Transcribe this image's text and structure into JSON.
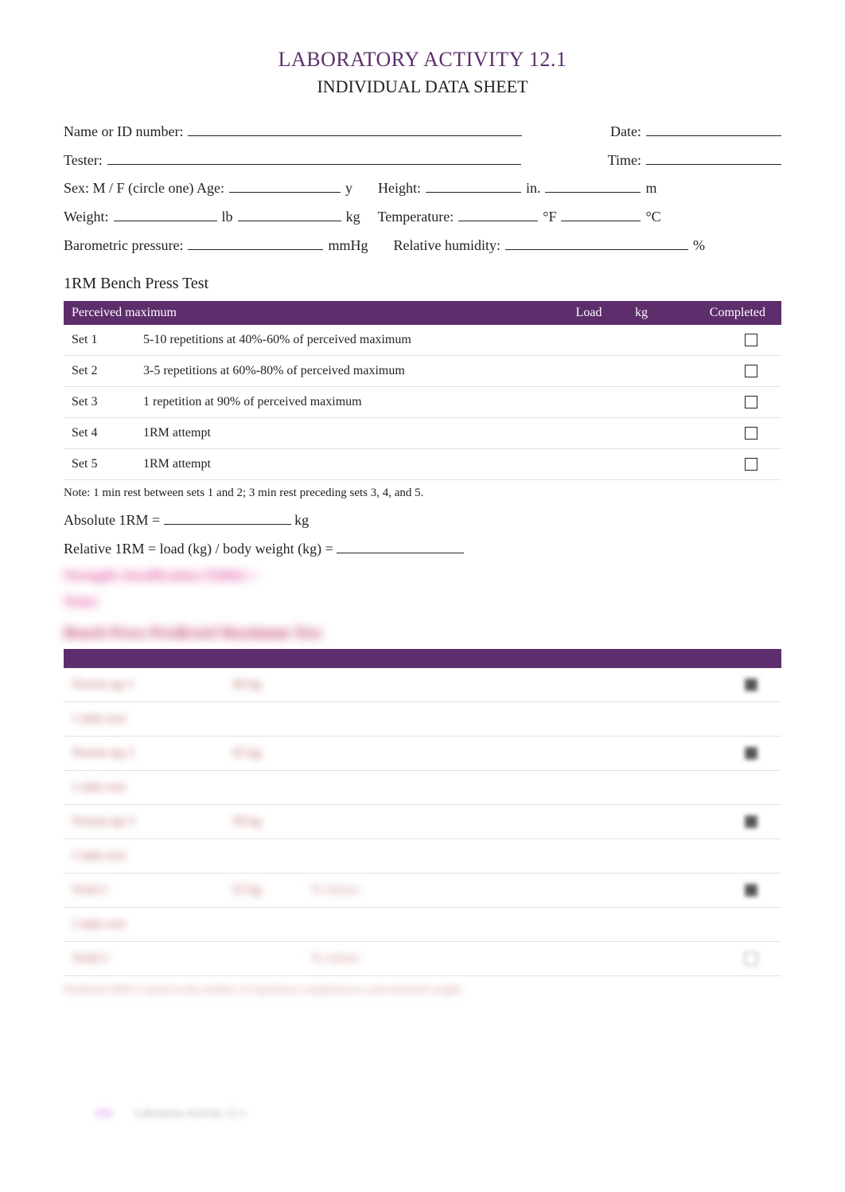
{
  "header": {
    "title": "LABORATORY ACTIVITY 12.1",
    "subtitle": "INDIVIDUAL DATA SHEET"
  },
  "form": {
    "name_label": "Name or ID number:",
    "name_value": "",
    "date_label": "Date:",
    "date_value": "",
    "tester_label": "Tester:",
    "tester_value": "",
    "time_label": "Time:",
    "time_value": "",
    "sex_label": "Sex: M / F (circle one) Age:",
    "age_value": "",
    "age_unit": "y",
    "height_label": "Height:",
    "height_in_value": "",
    "height_in_unit": "in.",
    "height_m_value": "",
    "height_m_unit": "m",
    "weight_label": "Weight:",
    "weight_lb_value": "",
    "weight_lb_unit": "lb",
    "weight_kg_value": "",
    "weight_kg_unit": "kg",
    "temp_label": "Temperature:",
    "temp_f_value": "",
    "temp_f_unit": "°F",
    "temp_c_value": "",
    "temp_c_unit": "°C",
    "baro_label": "Barometric pressure:",
    "baro_value": "",
    "baro_unit": "mmHg",
    "humidity_label": "Relative humidity:",
    "humidity_value": "",
    "humidity_unit": "%"
  },
  "test1": {
    "heading": "1RM Bench Press Test",
    "columns": {
      "perceived": "Perceived maximum",
      "load": "Load",
      "kg": "kg",
      "completed": "Completed"
    },
    "rows": [
      {
        "set": "Set 1",
        "desc": "5-10 repetitions at 40%-60% of perceived maximum",
        "load": "",
        "kg": "",
        "completed": false
      },
      {
        "set": "Set 2",
        "desc": "3-5 repetitions at 60%-80% of perceived maximum",
        "load": "",
        "kg": "",
        "completed": false
      },
      {
        "set": "Set 3",
        "desc": "1 repetition at 90% of perceived maximum",
        "load": "",
        "kg": "",
        "completed": false
      },
      {
        "set": "Set 4",
        "desc": "1RM attempt",
        "load": "",
        "kg": "",
        "completed": false
      },
      {
        "set": "Set 5",
        "desc": "1RM attempt",
        "load": "",
        "kg": "",
        "completed": false
      }
    ],
    "note_label": "Note:",
    "note_text": "1 min rest between sets 1 and 2; 3 min rest preceding sets 3, 4, and 5.",
    "absolute_label": "Absolute 1RM =",
    "absolute_unit": "kg",
    "relative_label": "Relative 1RM = load (kg) / body weight (kg) ="
  },
  "obscured": {
    "line1": "Strength classification (Table) =",
    "line2": "Notes",
    "heading2": "Bench Press Predicted Maximum Test"
  },
  "test2": {
    "rows": [
      {
        "label": "Warm-up 1",
        "val": "40 kg",
        "reps": "",
        "col3": "",
        "ck": true
      },
      {
        "label": "1 min rest",
        "val": "",
        "reps": "",
        "col3": "",
        "ck": null
      },
      {
        "label": "Warm-up 2",
        "val": "45 kg",
        "reps": "",
        "col3": "",
        "ck": true
      },
      {
        "label": "1 min rest",
        "val": "",
        "reps": "",
        "col3": "",
        "ck": null
      },
      {
        "label": "Warm-up 3",
        "val": "50 kg",
        "reps": "",
        "col3": "",
        "ck": true
      },
      {
        "label": "1 min rest",
        "val": "",
        "reps": "",
        "col3": "",
        "ck": null
      },
      {
        "label": "Trial 1",
        "val": "55 kg",
        "reps": "To failure",
        "col3": "",
        "ck": true
      },
      {
        "label": "3 min rest",
        "val": "",
        "reps": "",
        "col3": "",
        "ck": null
      },
      {
        "label": "Trial 2",
        "val": "",
        "reps": "To failure",
        "col3": "",
        "ck": false
      }
    ],
    "footer": "Predicted 1RM is based on the number of repetitions completed at a sub-maximal weight."
  },
  "footer": {
    "page_num": "152",
    "page_title": "Laboratory Activity 12.1"
  }
}
